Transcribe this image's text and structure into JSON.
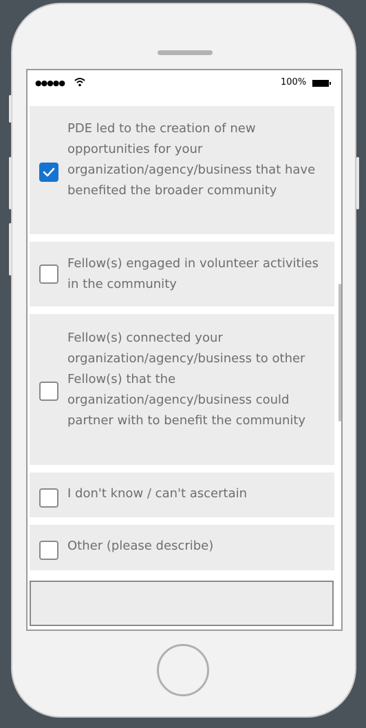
{
  "status_bar": {
    "signal": "●●●●●",
    "battery_percent": "100%"
  },
  "question": {
    "options": [
      {
        "label": "PDE led to the creation of new opportunities for your organization/agency/business that have benefited the broader community",
        "checked": true
      },
      {
        "label": "Fellow(s) engaged in volunteer activities in the community",
        "checked": false
      },
      {
        "label": "Fellow(s) connected your organization/agency/business to other Fellow(s) that the organization/agency/business could partner with to benefit the community",
        "checked": false
      },
      {
        "label": "I don't know / can't ascertain",
        "checked": false
      },
      {
        "label": "Other (please describe)",
        "checked": false
      }
    ],
    "other_input_value": ""
  },
  "colors": {
    "accent": "#1773d0",
    "option_background": "#ececec",
    "label_text": "#6e6e6e"
  }
}
